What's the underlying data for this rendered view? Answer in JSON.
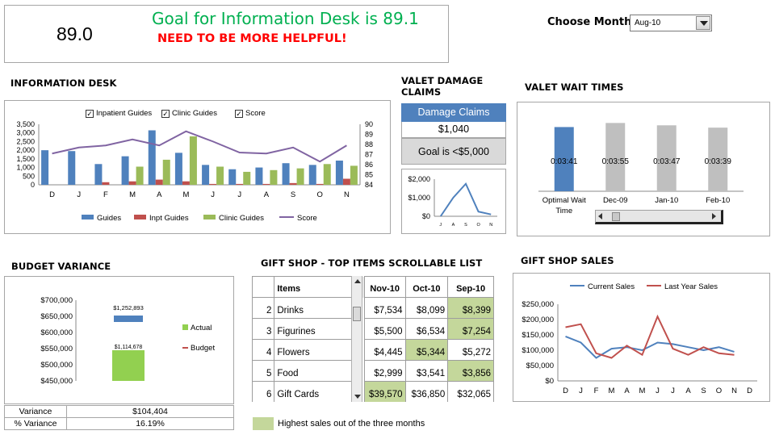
{
  "score_box": {
    "score": "89.0",
    "goal_text": "Goal for Information Desk is 89.1",
    "message": "NEED TO BE MORE HELPFUL!",
    "goal_color": "#00b050",
    "message_color": "#ff0000"
  },
  "month_picker": {
    "label": "Choose Month",
    "selected": "Aug-10"
  },
  "info_desk": {
    "title": "INFORMATION  DESK",
    "checkboxes": [
      {
        "label": "Inpatient Guides",
        "checked": true
      },
      {
        "label": "Clinic Guides",
        "checked": true
      },
      {
        "label": "Score",
        "checked": true
      }
    ],
    "legend": [
      "Guides",
      "Inpt Guides",
      "Clinic Guides",
      "Score"
    ]
  },
  "valet_damage": {
    "title_line1": "VALET  DAMAGE",
    "title_line2": "CLAIMS",
    "header": "Damage Claims",
    "value": "$1,040",
    "goal": "Goal is <$5,000"
  },
  "valet_wait": {
    "title": "VALET  WAIT  TIMES"
  },
  "budget": {
    "title": "BUDGET  VARIANCE",
    "legend": [
      "Actual",
      "Budget"
    ],
    "rows": [
      {
        "label": "Variance",
        "value": "$104,404"
      },
      {
        "label": "% Variance",
        "value": "16.19%"
      }
    ]
  },
  "gift_list": {
    "title": "GIFT  SHOP  - TOP ITEMS  SCROLLABLE  LIST",
    "columns": [
      "Items",
      "Nov-10",
      "Oct-10",
      "Sep-10"
    ],
    "rows": [
      {
        "n": "2",
        "item": "Drinks",
        "v": [
          "$7,534",
          "$8,099",
          "$8,399"
        ],
        "hi": 2
      },
      {
        "n": "3",
        "item": "Figurines",
        "v": [
          "$5,500",
          "$6,534",
          "$7,254"
        ],
        "hi": 2
      },
      {
        "n": "4",
        "item": "Flowers",
        "v": [
          "$4,445",
          "$5,344",
          "$5,272"
        ],
        "hi": 1
      },
      {
        "n": "5",
        "item": "Food",
        "v": [
          "$2,999",
          "$3,541",
          "$3,856"
        ],
        "hi": 2
      },
      {
        "n": "6",
        "item": "Gift Cards",
        "v": [
          "$39,570",
          "$36,850",
          "$32,065"
        ],
        "hi": 0
      }
    ],
    "legend_text": "Highest sales out of the three months",
    "highlight_color": "#c4d79b"
  },
  "gift_sales": {
    "title": "GIFT  SHOP  SALES"
  },
  "chart_data": [
    {
      "id": "info_desk",
      "type": "bar",
      "categories": [
        "D",
        "J",
        "F",
        "M",
        "A",
        "M",
        "J",
        "J",
        "A",
        "S",
        "O",
        "N"
      ],
      "series": [
        {
          "name": "Guides",
          "values": [
            2000,
            1950,
            1200,
            1650,
            3150,
            1850,
            1150,
            900,
            1000,
            1250,
            1150,
            1400
          ],
          "color": "#4f81bd"
        },
        {
          "name": "Inpt Guides",
          "values": [
            0,
            0,
            150,
            200,
            300,
            200,
            50,
            50,
            50,
            100,
            50,
            350
          ],
          "color": "#c0504d"
        },
        {
          "name": "Clinic Guides",
          "values": [
            0,
            0,
            0,
            1050,
            1450,
            2800,
            1050,
            750,
            850,
            950,
            1200,
            1100
          ],
          "color": "#9bbb59"
        },
        {
          "name": "Score",
          "values": [
            87.1,
            87.7,
            87.9,
            88.5,
            87.9,
            89.3,
            88.3,
            87.2,
            87.1,
            87.7,
            86.3,
            87.9
          ],
          "color": "#8064a2",
          "axis": "right"
        }
      ],
      "ylim": [
        0,
        3500
      ],
      "yticks": [
        "0",
        "500",
        "1,000",
        "1,500",
        "2,000",
        "2,500",
        "3,000",
        "3,500"
      ],
      "y2lim": [
        84,
        90
      ],
      "y2ticks": [
        "84",
        "85",
        "86",
        "87",
        "88",
        "89",
        "90"
      ]
    },
    {
      "id": "valet_damage_mini",
      "type": "line",
      "categories": [
        "J",
        "A",
        "S",
        "O",
        "N"
      ],
      "values": [
        0,
        1000,
        1750,
        250,
        100
      ],
      "ylim": [
        0,
        2000
      ],
      "yticks": [
        "$0",
        "$1,000",
        "$2,000"
      ],
      "color": "#4f81bd"
    },
    {
      "id": "valet_wait",
      "type": "bar",
      "categories": [
        "Optimal Wait Time",
        "Dec-09",
        "Jan-10",
        "Feb-10"
      ],
      "values": [
        221,
        235,
        227,
        219
      ],
      "labels": [
        "0:03:41",
        "0:03:55",
        "0:03:47",
        "0:03:39"
      ],
      "colors": [
        "#4f81bd",
        "#bfbfbf",
        "#bfbfbf",
        "#bfbfbf"
      ]
    },
    {
      "id": "budget",
      "type": "bar",
      "ylim": [
        450000,
        700000
      ],
      "yticks": [
        "$450,000",
        "$500,000",
        "$550,000",
        "$600,000",
        "$650,000",
        "$700,000"
      ],
      "actual": 1114678,
      "budget": 1252893,
      "actual_label": "$1,114,678",
      "budget_label": "$1,252,893"
    },
    {
      "id": "gift_sales",
      "type": "line",
      "categories": [
        "D",
        "J",
        "F",
        "M",
        "A",
        "M",
        "J",
        "J",
        "A",
        "S",
        "O",
        "N",
        "D"
      ],
      "series": [
        {
          "name": "Current Sales",
          "values": [
            145000,
            125000,
            75000,
            105000,
            110000,
            100000,
            125000,
            120000,
            110000,
            100000,
            110000,
            95000
          ],
          "color": "#4f81bd"
        },
        {
          "name": "Last Year Sales",
          "values": [
            175000,
            185000,
            90000,
            75000,
            115000,
            85000,
            210000,
            105000,
            85000,
            110000,
            90000,
            85000
          ],
          "color": "#c0504d"
        }
      ],
      "ylim": [
        0,
        250000
      ],
      "yticks": [
        "$0",
        "$50,000",
        "$100,000",
        "$150,000",
        "$200,000",
        "$250,000"
      ]
    }
  ]
}
